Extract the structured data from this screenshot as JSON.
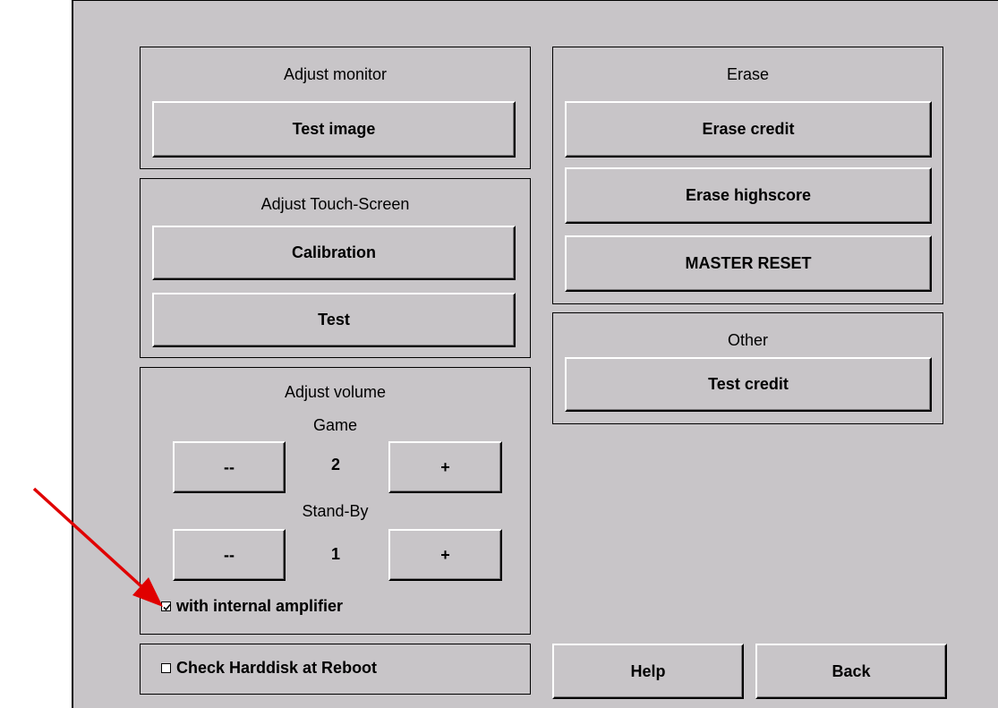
{
  "sections": {
    "adjust_monitor": {
      "title": "Adjust monitor",
      "test_image": "Test image"
    },
    "adjust_touch": {
      "title": "Adjust Touch-Screen",
      "calibration": "Calibration",
      "test": "Test"
    },
    "adjust_volume": {
      "title": "Adjust volume",
      "game_label": "Game",
      "game_minus": "--",
      "game_value": "2",
      "game_plus": "+",
      "standby_label": "Stand-By",
      "standby_minus": "--",
      "standby_value": "1",
      "standby_plus": "+",
      "amplifier_label": "with internal amplifier",
      "amplifier_checked": true
    },
    "harddisk": {
      "label": "Check Harddisk at Reboot",
      "checked": false
    },
    "erase": {
      "title": "Erase",
      "erase_credit": "Erase credit",
      "erase_highscore": "Erase highscore",
      "master_reset": "MASTER RESET"
    },
    "other": {
      "title": "Other",
      "test_credit": "Test credit"
    }
  },
  "footer": {
    "help": "Help",
    "back": "Back"
  },
  "annotation": {
    "arrow_color": "#e00000"
  }
}
